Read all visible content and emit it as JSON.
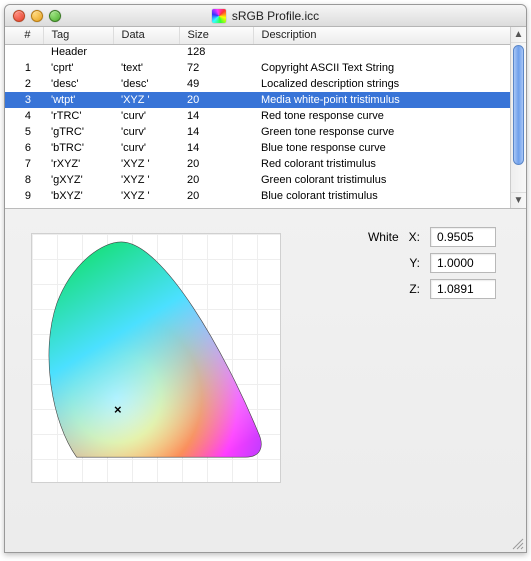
{
  "window": {
    "title": "sRGB Profile.icc"
  },
  "columns": {
    "num": "#",
    "tag": "Tag",
    "data": "Data",
    "size": "Size",
    "desc": "Description"
  },
  "rows": [
    {
      "num": "",
      "tag": "Header",
      "data": "",
      "size": "128",
      "desc": "",
      "selected": false
    },
    {
      "num": "1",
      "tag": "'cprt'",
      "data": "'text'",
      "size": "72",
      "desc": "Copyright ASCII Text String",
      "selected": false
    },
    {
      "num": "2",
      "tag": "'desc'",
      "data": "'desc'",
      "size": "49",
      "desc": "Localized description strings",
      "selected": false
    },
    {
      "num": "3",
      "tag": "'wtpt'",
      "data": "'XYZ '",
      "size": "20",
      "desc": "Media white-point tristimulus",
      "selected": true
    },
    {
      "num": "4",
      "tag": "'rTRC'",
      "data": "'curv'",
      "size": "14",
      "desc": "Red tone response curve",
      "selected": false
    },
    {
      "num": "5",
      "tag": "'gTRC'",
      "data": "'curv'",
      "size": "14",
      "desc": "Green tone response curve",
      "selected": false
    },
    {
      "num": "6",
      "tag": "'bTRC'",
      "data": "'curv'",
      "size": "14",
      "desc": "Blue tone response curve",
      "selected": false
    },
    {
      "num": "7",
      "tag": "'rXYZ'",
      "data": "'XYZ '",
      "size": "20",
      "desc": "Red colorant tristimulus",
      "selected": false
    },
    {
      "num": "8",
      "tag": "'gXYZ'",
      "data": "'XYZ '",
      "size": "20",
      "desc": "Green colorant tristimulus",
      "selected": false
    },
    {
      "num": "9",
      "tag": "'bXYZ'",
      "data": "'XYZ '",
      "size": "20",
      "desc": "Blue colorant tristimulus",
      "selected": false
    }
  ],
  "detail": {
    "field_label": "White",
    "labels": {
      "x": "X:",
      "y": "Y:",
      "z": "Z:"
    },
    "values": {
      "x": "0.9505",
      "y": "1.0000",
      "z": "1.0891"
    }
  }
}
